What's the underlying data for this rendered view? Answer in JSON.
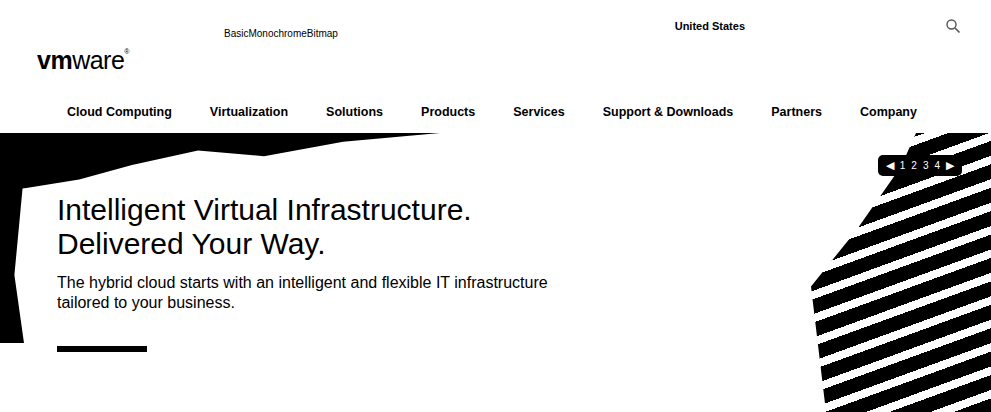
{
  "header": {
    "label": "BasicMonochromeBitmap",
    "region": "United States"
  },
  "logo": {
    "bold": "vm",
    "light": "ware",
    "mark": "®"
  },
  "nav": {
    "items": [
      "Cloud Computing",
      "Virtualization",
      "Solutions",
      "Products",
      "Services",
      "Support & Downloads",
      "Partners",
      "Company"
    ]
  },
  "hero": {
    "headline": [
      "Intelligent Virtual Infrastructure.",
      "Delivered Your Way."
    ],
    "subtitle": [
      "The hybrid cloud starts with an intelligent and flexible IT infrastructure",
      "tailored to your business."
    ],
    "pager": {
      "prev": "◀",
      "next": "▶",
      "pages": [
        "1",
        "2",
        "3",
        "4"
      ]
    }
  }
}
